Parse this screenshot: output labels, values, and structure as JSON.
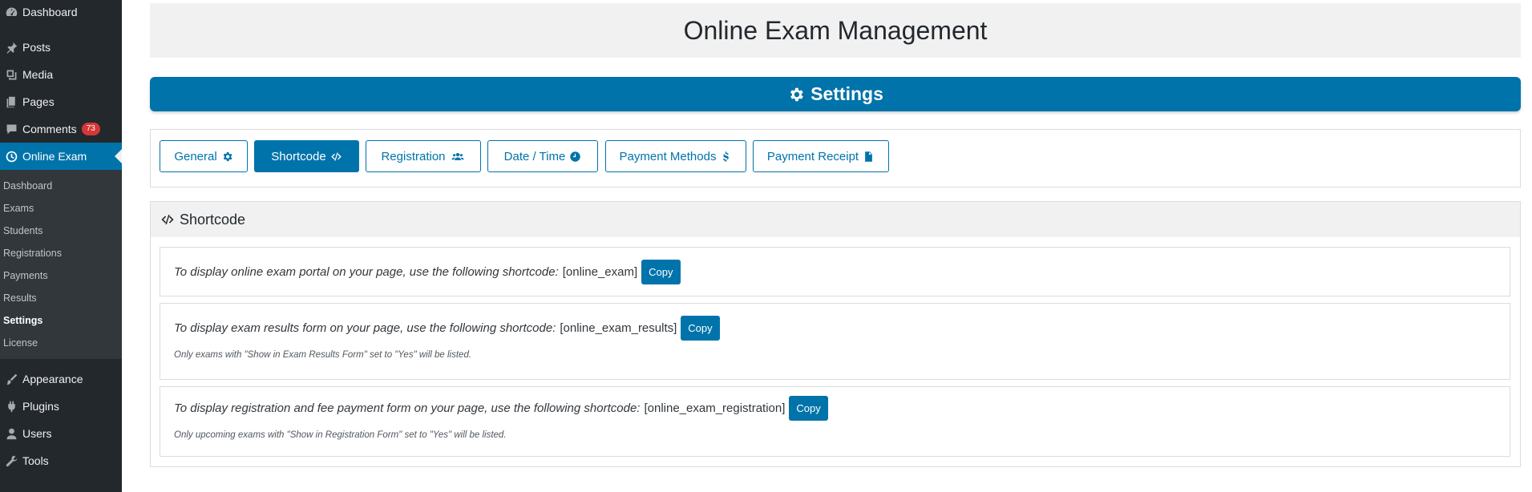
{
  "sidebar": {
    "top_items": [
      {
        "label": "Dashboard",
        "icon": "dashboard-icon"
      },
      {
        "label": "Posts",
        "icon": "pin-icon"
      },
      {
        "label": "Media",
        "icon": "media-icon"
      },
      {
        "label": "Pages",
        "icon": "pages-icon"
      },
      {
        "label": "Comments",
        "icon": "comments-icon",
        "badge": "73"
      },
      {
        "label": "Online Exam",
        "icon": "clock-icon",
        "active": true
      }
    ],
    "submenu": [
      "Dashboard",
      "Exams",
      "Students",
      "Registrations",
      "Payments",
      "Results",
      "Settings",
      "License"
    ],
    "submenu_current": "Settings",
    "bottom_items": [
      {
        "label": "Appearance",
        "icon": "brush-icon"
      },
      {
        "label": "Plugins",
        "icon": "plug-icon"
      },
      {
        "label": "Users",
        "icon": "users-icon"
      },
      {
        "label": "Tools",
        "icon": "wrench-icon"
      }
    ]
  },
  "page": {
    "title": "Online Exam Management",
    "settings_label": "Settings"
  },
  "tabs": [
    {
      "label": "General",
      "icon": "gear-icon"
    },
    {
      "label": "Shortcode",
      "icon": "code-icon",
      "active": true
    },
    {
      "label": "Registration",
      "icon": "users-icon"
    },
    {
      "label": "Date / Time",
      "icon": "clock-icon"
    },
    {
      "label": "Payment Methods",
      "icon": "dollar-icon"
    },
    {
      "label": "Payment Receipt",
      "icon": "file-icon"
    }
  ],
  "shortcode": {
    "heading": "Shortcode",
    "rows": [
      {
        "text": "To display online exam portal on your page, use the following shortcode:",
        "code": "[online_exam]",
        "button": "Copy",
        "note": ""
      },
      {
        "text": "To display exam results form on your page, use the following shortcode:",
        "code": "[online_exam_results]",
        "button": "Copy",
        "note": "Only exams with \"Show in Exam Results Form\" set to \"Yes\" will be listed."
      },
      {
        "text": "To display registration and fee payment form on your page, use the following shortcode:",
        "code": "[online_exam_registration]",
        "button": "Copy",
        "note": "Only upcoming exams with \"Show in Registration Form\" set to \"Yes\" will be listed."
      }
    ]
  },
  "colors": {
    "accent": "#0073aa",
    "sidebar_bg": "#23282d",
    "badge": "#d63638"
  }
}
